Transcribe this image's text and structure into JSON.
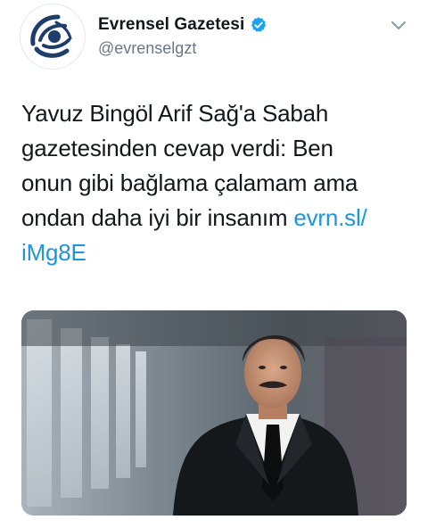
{
  "author": {
    "display_name": "Evrensel Gazetesi",
    "handle": "@evrenselgzt",
    "verified": true,
    "avatar_icon": "evrensel-globe-logo",
    "brand_color": "#1f3d6b"
  },
  "menu": {
    "icon": "chevron-down-icon"
  },
  "tweet": {
    "text_lines": [
      "Yavuz Bingöl Arif Sağ'a Sabah",
      "gazetesinden cevap verdi: Ben",
      "onun gibi bağlama çalamam ama",
      "ondan daha iyi bir insanım "
    ],
    "link_part1": "evrn.sl/",
    "link_part2": "iMg8E",
    "link_color": "#1b95e0"
  },
  "media": {
    "type": "photo"
  }
}
